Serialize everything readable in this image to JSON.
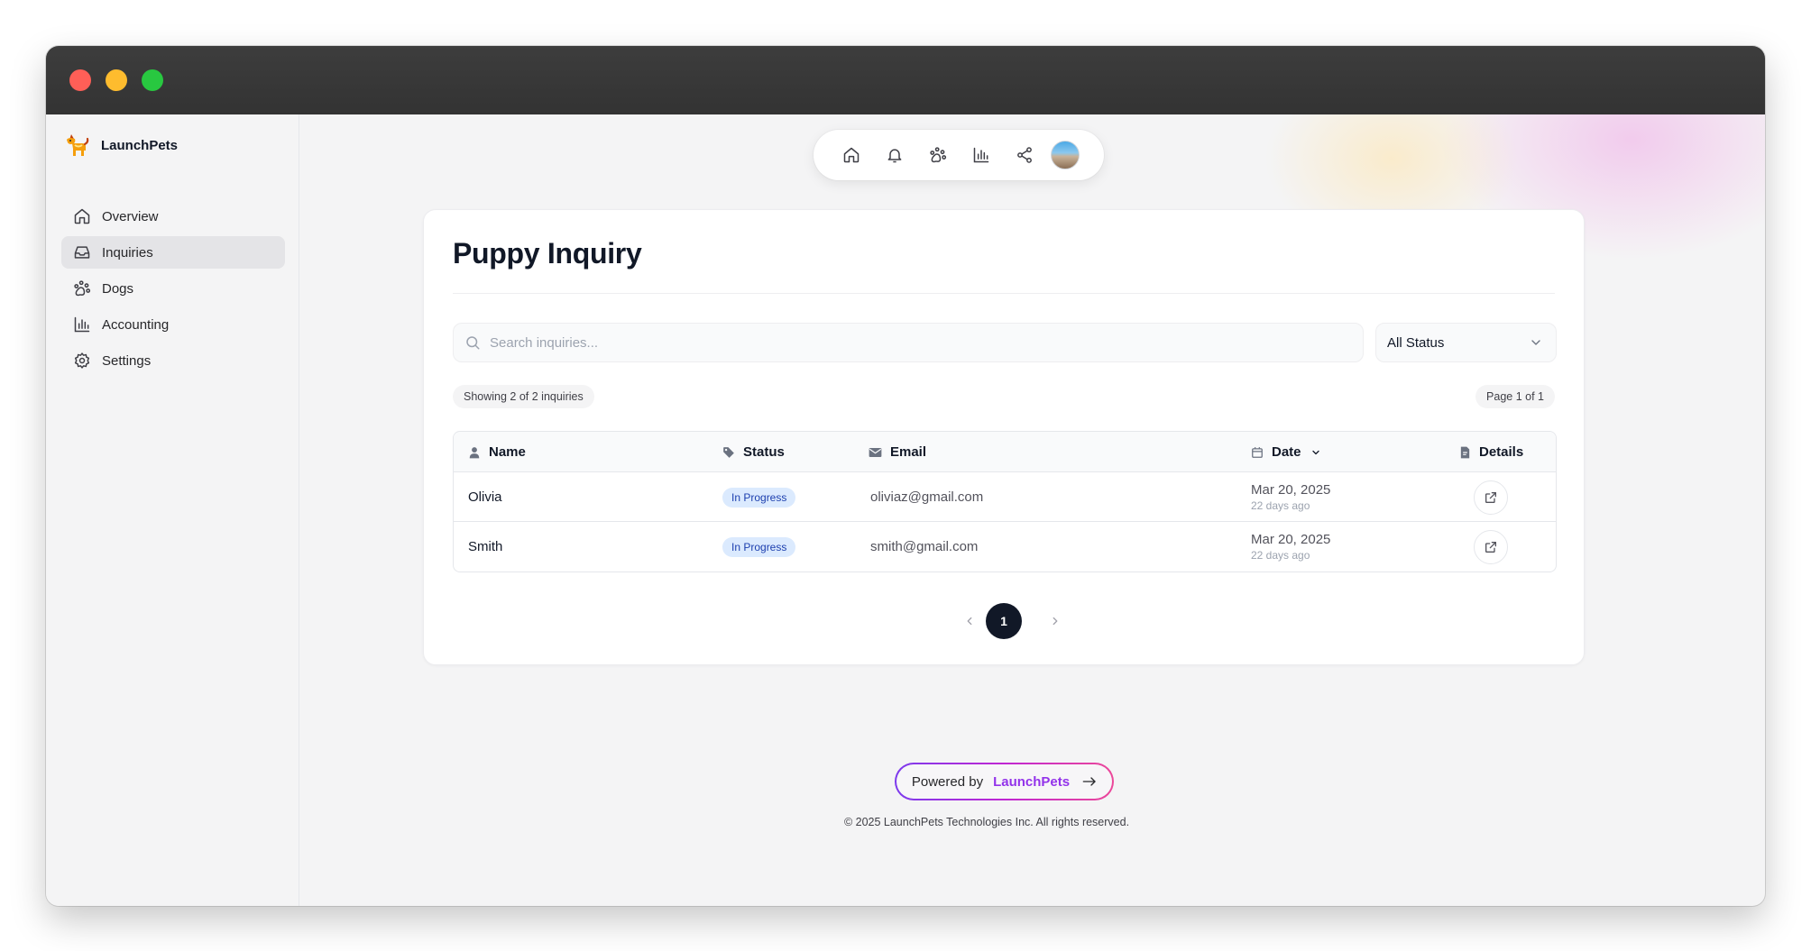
{
  "app": {
    "brand_name": "LaunchPets"
  },
  "sidebar": {
    "items": [
      {
        "label": "Overview",
        "icon": "home-icon",
        "active": false
      },
      {
        "label": "Inquiries",
        "icon": "inbox-icon",
        "active": true
      },
      {
        "label": "Dogs",
        "icon": "paw-icon",
        "active": false
      },
      {
        "label": "Accounting",
        "icon": "bar-chart-icon",
        "active": false
      },
      {
        "label": "Settings",
        "icon": "gear-icon",
        "active": false
      }
    ]
  },
  "topnav": {
    "icons": [
      "home-icon",
      "bell-icon",
      "paw-icon",
      "bar-chart-icon",
      "share-icon",
      "avatar"
    ]
  },
  "page": {
    "title": "Puppy Inquiry",
    "search_placeholder": "Search inquiries...",
    "status_filter": "All Status",
    "showing": "Showing 2 of 2 inquiries",
    "page_info": "Page 1 of 1"
  },
  "table": {
    "columns": [
      {
        "label": "Name",
        "icon": "user-icon"
      },
      {
        "label": "Status",
        "icon": "tag-icon"
      },
      {
        "label": "Email",
        "icon": "mail-icon"
      },
      {
        "label": "Date",
        "icon": "calendar-icon",
        "sortable": true
      },
      {
        "label": "Details",
        "icon": "document-icon"
      }
    ],
    "rows": [
      {
        "name": "Olivia",
        "status": "In Progress",
        "email": "oliviaz@gmail.com",
        "date": "Mar 20, 2025",
        "relative": "22 days ago"
      },
      {
        "name": "Smith",
        "status": "In Progress",
        "email": "smith@gmail.com",
        "date": "Mar 20, 2025",
        "relative": "22 days ago"
      }
    ]
  },
  "pagination": {
    "current": "1"
  },
  "footer": {
    "powered_by": "Powered by",
    "powered_brand": "LaunchPets",
    "copyright": "© 2025 LaunchPets Technologies Inc. All rights reserved."
  },
  "colors": {
    "accent": "#111827",
    "badge_bg": "#dbeafe",
    "badge_text": "#1e40af",
    "gradient_start": "#7c3aed",
    "gradient_end": "#ec4899"
  }
}
